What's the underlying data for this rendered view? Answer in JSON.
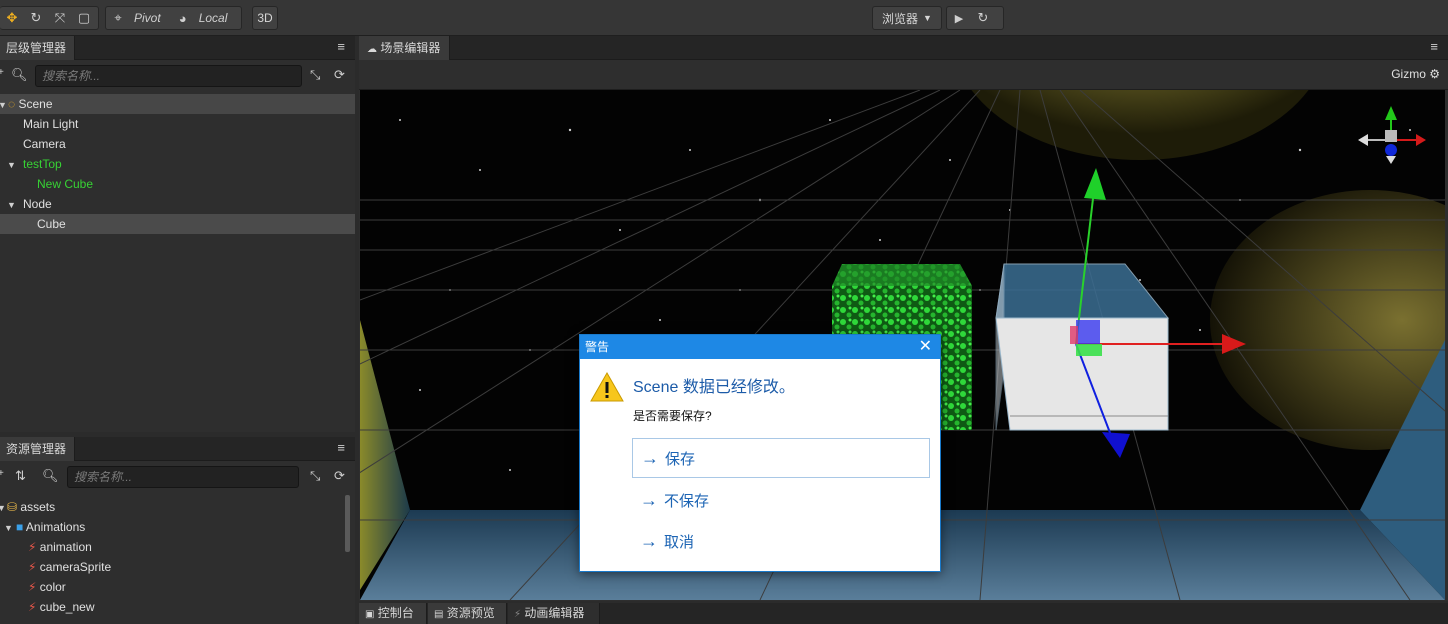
{
  "toolbar": {
    "pivot_label": "Pivot",
    "local_label": "Local",
    "three_d_label": "3D",
    "browser_label": "浏览器"
  },
  "hierarchy": {
    "tab": "层级管理器",
    "search_placeholder": "搜索名称...",
    "items": [
      {
        "label": "Scene",
        "depth": 0,
        "state": "scene"
      },
      {
        "label": "Main Light",
        "depth": 1
      },
      {
        "label": "Camera",
        "depth": 1
      },
      {
        "label": "testTop",
        "depth": 1,
        "color": "green",
        "expanded": true
      },
      {
        "label": "New Cube",
        "depth": 2,
        "color": "green"
      },
      {
        "label": "Node",
        "depth": 1,
        "expanded": true
      },
      {
        "label": "Cube",
        "depth": 2,
        "selected": true
      }
    ]
  },
  "assets": {
    "tab": "资源管理器",
    "search_placeholder": "搜索名称...",
    "items": [
      {
        "label": "assets",
        "depth": 0,
        "icon": "database-icon"
      },
      {
        "label": "Animations",
        "depth": 1,
        "icon": "folder-icon"
      },
      {
        "label": "animation",
        "depth": 2,
        "icon": "animation-clip-icon"
      },
      {
        "label": "cameraSprite",
        "depth": 2,
        "icon": "animation-clip-icon"
      },
      {
        "label": "color",
        "depth": 2,
        "icon": "animation-clip-icon"
      },
      {
        "label": "cube_new",
        "depth": 2,
        "icon": "animation-clip-icon"
      }
    ]
  },
  "scene_editor": {
    "tab": "场景编辑器",
    "gizmo_label": "Gizmo"
  },
  "bottom_tabs": [
    "控制台",
    "资源预览",
    "动画编辑器"
  ],
  "dialog": {
    "title": "警告",
    "message": "Scene 数据已经修改。",
    "sub_message": "是否需要保存?",
    "commands": [
      "保存",
      "不保存",
      "取消"
    ]
  },
  "colors": {
    "accent": "#1e88e5",
    "node_green": "#37d234"
  }
}
